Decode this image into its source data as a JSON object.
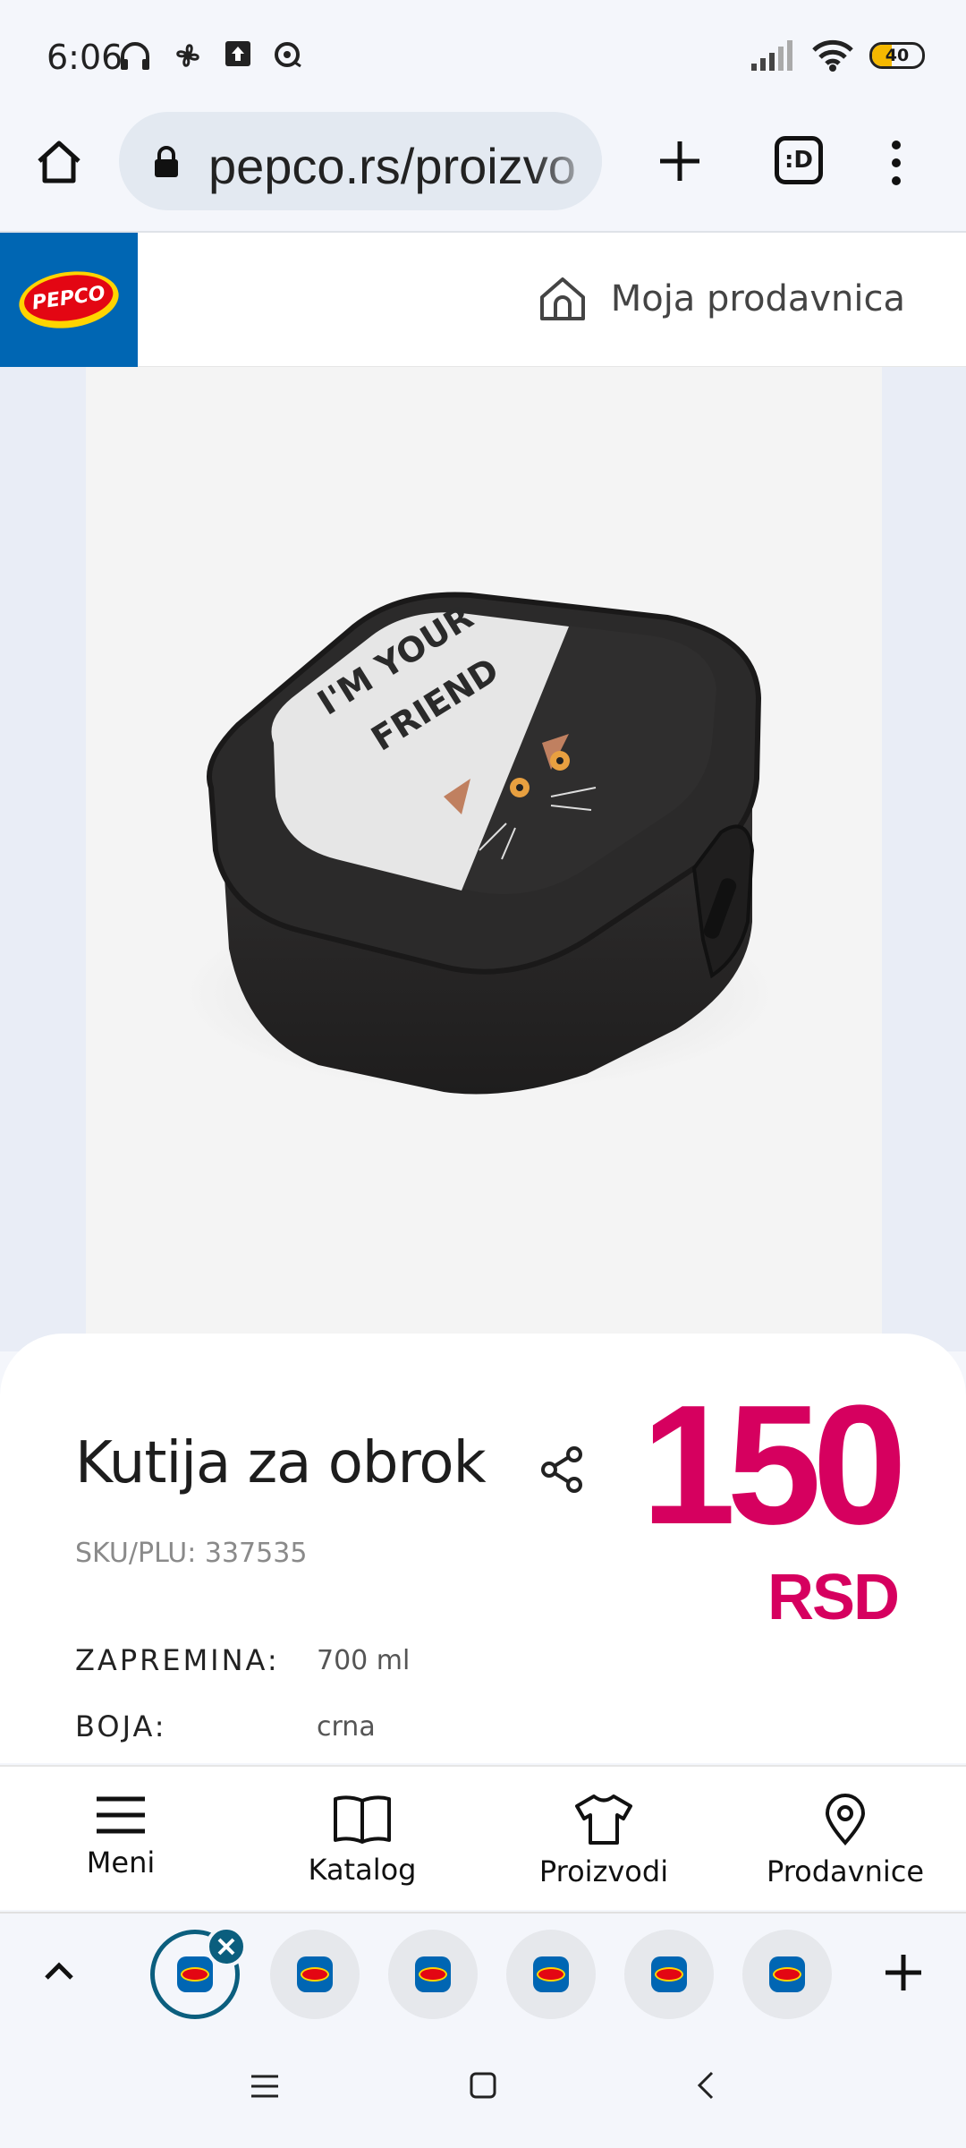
{
  "status_bar": {
    "time": "6:06",
    "battery_level": 40,
    "battery_text": "40",
    "icons_left": [
      "headphones-icon",
      "fan-icon",
      "upload-icon",
      "record-icon"
    ],
    "icons_right": [
      "signal-icon",
      "wifi-icon",
      "battery-icon"
    ]
  },
  "browser": {
    "url": "pepco.rs/proizvo",
    "tabs_count_label": ":D"
  },
  "site_header": {
    "logo_text": "PEPCO",
    "store_label": "Moja prodavnica"
  },
  "product": {
    "title": "Kutija za obrok",
    "sku": "SKU/PLU: 337535",
    "price": "150",
    "currency": "RSD",
    "image_text_line1": "I'M YOUR",
    "image_text_line2": "FRIEND",
    "attributes": [
      {
        "label": "ZAPREMINA:",
        "value": "700 ml"
      },
      {
        "label": "BOJA:",
        "value": "crna"
      }
    ]
  },
  "bottom_nav": {
    "items": [
      {
        "label": "Meni",
        "icon": "menu-icon"
      },
      {
        "label": "Katalog",
        "icon": "book-icon"
      },
      {
        "label": "Proizvodi",
        "icon": "tshirt-icon"
      },
      {
        "label": "Prodavnice",
        "icon": "location-pin-icon"
      }
    ]
  },
  "tab_strip": {
    "logo_text": "PEPCO"
  },
  "colors": {
    "brand_blue": "#0066b3",
    "brand_red": "#e30613",
    "brand_yellow": "#ffd400",
    "price_pink": "#d6005f"
  }
}
